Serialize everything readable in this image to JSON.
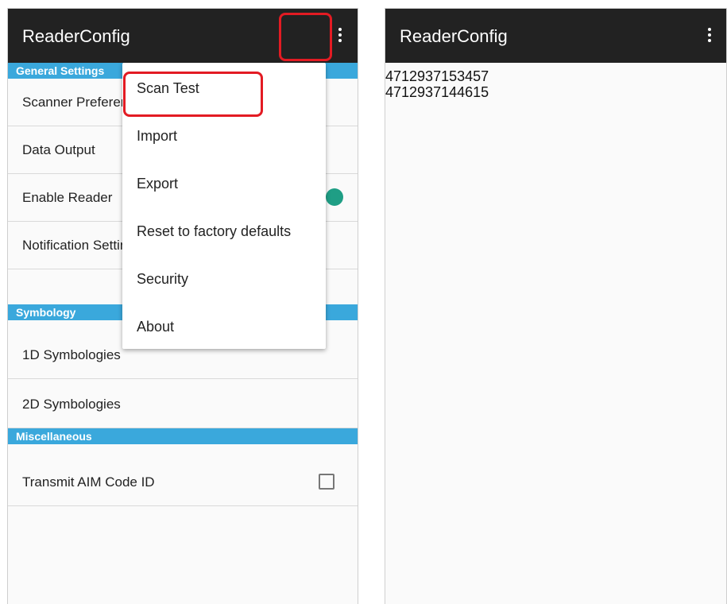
{
  "app": {
    "title": "ReaderConfig"
  },
  "left_screen": {
    "sections": [
      {
        "header": "General Settings",
        "items": [
          "Scanner Preferences",
          "Data Output",
          "Enable Reader",
          "Notification Settings"
        ]
      },
      {
        "header": "Symbology",
        "items": [
          "1D Symbologies",
          "2D Symbologies"
        ]
      },
      {
        "header": "Miscellaneous",
        "items": [
          "Transmit AIM Code ID"
        ]
      }
    ],
    "enable_reader_on": true,
    "transmit_aim_checked": false,
    "menu": {
      "items": [
        "Scan Test",
        "Import",
        "Export",
        "Reset to factory defaults",
        "Security",
        "About"
      ],
      "highlighted_item": "Scan Test"
    }
  },
  "right_screen": {
    "scan_results": [
      "4712937153457",
      "4712937144615"
    ]
  },
  "colors": {
    "appbar": "#222222",
    "section_header": "#3aa8dc",
    "toggle_on": "#1f9e85",
    "highlight": "#e31b23"
  },
  "icons": {
    "overflow": "more-vert-icon"
  }
}
